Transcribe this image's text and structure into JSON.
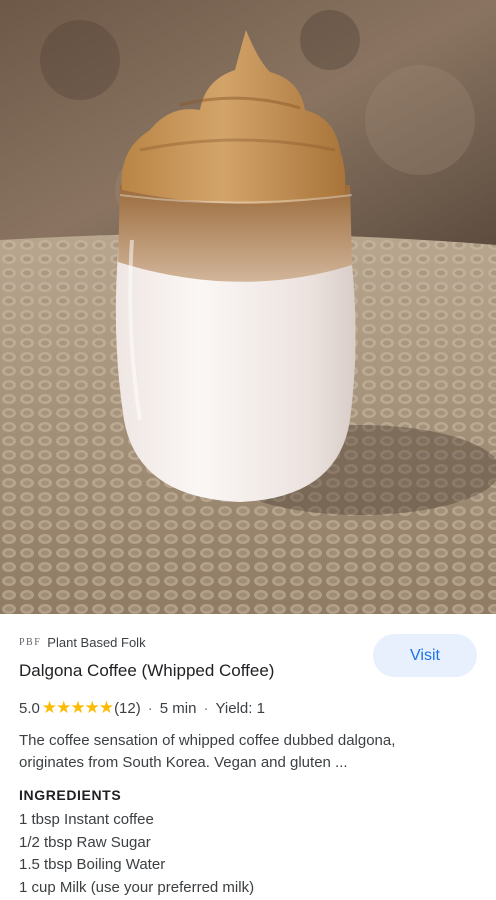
{
  "photo": {
    "alt_icon": "dalgona-coffee-photo"
  },
  "source": {
    "logo_text": "PBF",
    "name": "Plant Based Folk"
  },
  "visit_label": "Visit",
  "recipe": {
    "title": "Dalgona Coffee (Whipped Coffee)",
    "rating": "5.0",
    "stars": "★★★★★",
    "reviews": "(12)",
    "time": "5 min",
    "yield": "Yield: 1",
    "description": "The coffee sensation of whipped coffee dubbed dalgona, originates from South Korea. Vegan and gluten ..."
  },
  "ingredients": {
    "heading": "INGREDIENTS",
    "items": [
      "1 tbsp Instant coffee",
      "1/2 tbsp Raw Sugar",
      "1.5 tbsp Boiling Water",
      "1 cup Milk (use your preferred milk)"
    ]
  },
  "colors": {
    "accent": "#1a73e8",
    "button_bg": "#e8f0fe",
    "star": "#fbbc04"
  }
}
